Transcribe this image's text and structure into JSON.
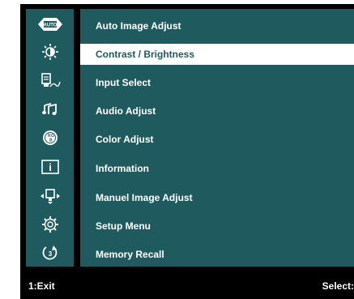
{
  "colors": {
    "panel": "#1e5a5e",
    "frame": "#000000",
    "text": "#ffffff",
    "selected_bg": "#ffffff",
    "selected_text": "#1e5a5e"
  },
  "sidebar": {
    "icons": [
      {
        "name": "auto-logo-icon",
        "label": "AUTO"
      },
      {
        "name": "brightness-sun-icon"
      },
      {
        "name": "input-select-icon"
      },
      {
        "name": "audio-music-icon"
      },
      {
        "name": "color-rgb-icon",
        "label": "RGB"
      },
      {
        "name": "information-icon",
        "label": "i"
      },
      {
        "name": "manual-adjust-icon"
      },
      {
        "name": "setup-gear-icon"
      },
      {
        "name": "memory-recall-icon"
      }
    ]
  },
  "menu": {
    "items": [
      {
        "label": "Auto Image Adjust",
        "selected": false
      },
      {
        "label": "Contrast / Brightness",
        "selected": true
      },
      {
        "label": "Input Select",
        "selected": false
      },
      {
        "label": "Audio Adjust",
        "selected": false
      },
      {
        "label": "Color Adjust",
        "selected": false
      },
      {
        "label": "Information",
        "selected": false
      },
      {
        "label": "Manuel Image Adjust",
        "selected": false
      },
      {
        "label": "Setup Menu",
        "selected": false
      },
      {
        "label": "Memory Recall",
        "selected": false
      }
    ]
  },
  "footer": {
    "exit_hint": "1:Exit",
    "select_hint": "Select:"
  }
}
